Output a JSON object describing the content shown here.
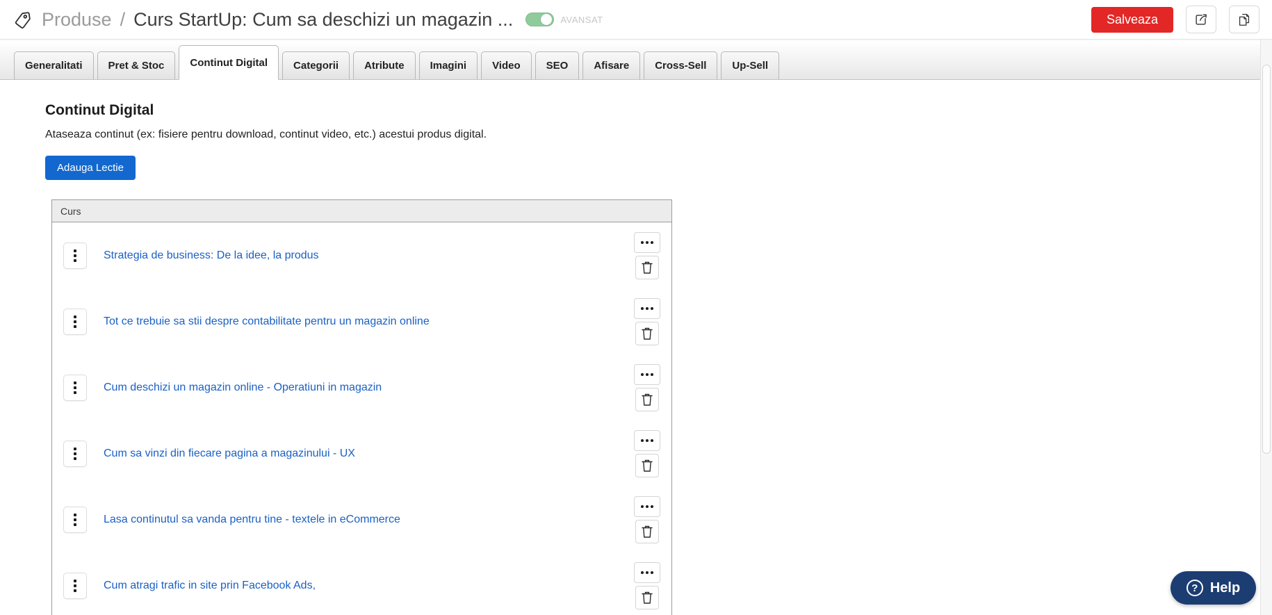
{
  "header": {
    "breadcrumb_root": "Produse",
    "breadcrumb_separator": "/",
    "product_title": "Curs StartUp: Cum sa deschizi un magazin ...",
    "advanced_toggle": {
      "label": "AVANSAT",
      "state": "on"
    },
    "save_button": "Salveaza",
    "icons": [
      "tag-icon",
      "export-icon",
      "duplicate-icon"
    ]
  },
  "tabs": {
    "active_index": 2,
    "items": [
      "Generalitati",
      "Pret & Stoc",
      "Continut Digital",
      "Categorii",
      "Atribute",
      "Imagini",
      "Video",
      "SEO",
      "Afisare",
      "Cross-Sell",
      "Up-Sell"
    ]
  },
  "content": {
    "title": "Continut Digital",
    "description": "Ataseaza continut (ex: fisiere pentru download, continut video, etc.) acestui produs digital.",
    "add_lesson_button": "Adauga Lectie",
    "table": {
      "header": "Curs",
      "lessons": [
        "Strategia de business: De la idee, la produs",
        "Tot ce trebuie sa stii despre contabilitate pentru un magazin online",
        "Cum deschizi un magazin online - Operatiuni in magazin",
        "Cum sa vinzi din fiecare pagina a magazinului - UX",
        "Lasa continutul sa vanda pentru tine - textele in eCommerce",
        "Cum atragi trafic in site prin Facebook Ads,"
      ]
    }
  },
  "help_button": {
    "label": "Help"
  },
  "colors": {
    "save_red": "#e32726",
    "primary_blue": "#1268cf",
    "link_blue": "#1a60c4",
    "help_navy": "#1c3d72",
    "toggle_green": "#90cb9b",
    "muted_gray": "#c6c6c6"
  }
}
